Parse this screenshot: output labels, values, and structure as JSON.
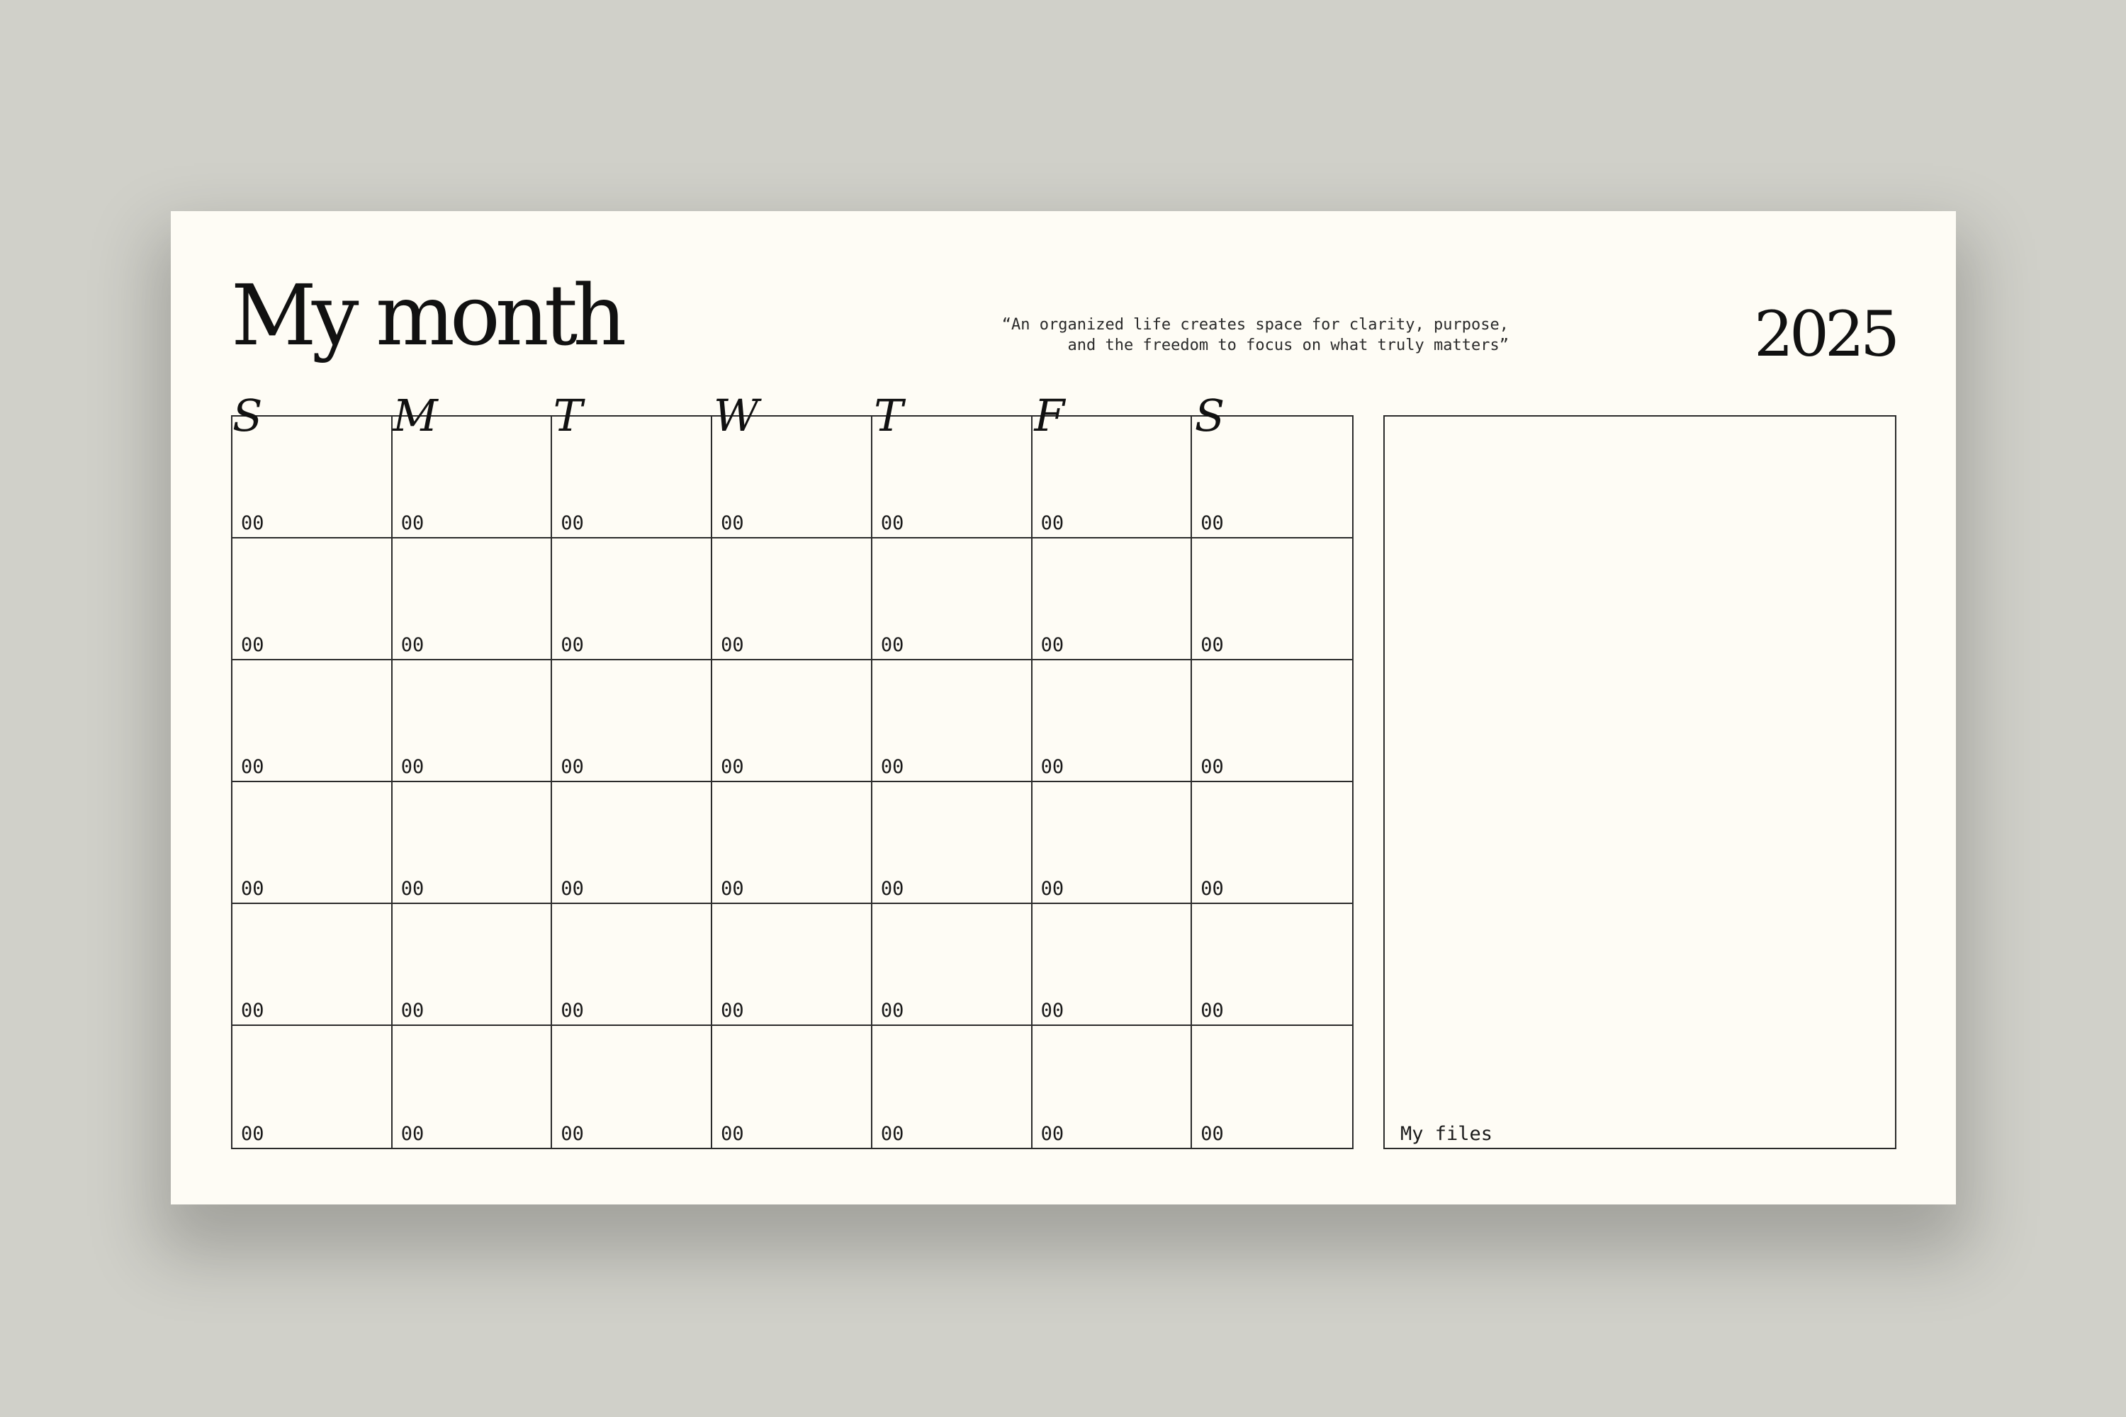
{
  "planner": {
    "title": "My month",
    "quote_line1": "“An organized life creates space for clarity, purpose,",
    "quote_line2": "and the freedom to focus on what truly matters”",
    "year": "2025"
  },
  "weekdays": [
    "S",
    "M",
    "T",
    "W",
    "T",
    "F",
    "S"
  ],
  "weeks": [
    [
      "00",
      "00",
      "00",
      "00",
      "00",
      "00",
      "00"
    ],
    [
      "00",
      "00",
      "00",
      "00",
      "00",
      "00",
      "00"
    ],
    [
      "00",
      "00",
      "00",
      "00",
      "00",
      "00",
      "00"
    ],
    [
      "00",
      "00",
      "00",
      "00",
      "00",
      "00",
      "00"
    ],
    [
      "00",
      "00",
      "00",
      "00",
      "00",
      "00",
      "00"
    ],
    [
      "00",
      "00",
      "00",
      "00",
      "00",
      "00",
      "00"
    ]
  ],
  "files": {
    "label": "My files"
  },
  "colors": {
    "background": "#d0d0c9",
    "card": "#fefcf5",
    "ink": "#111111",
    "grid_line": "#2b2b2b"
  }
}
